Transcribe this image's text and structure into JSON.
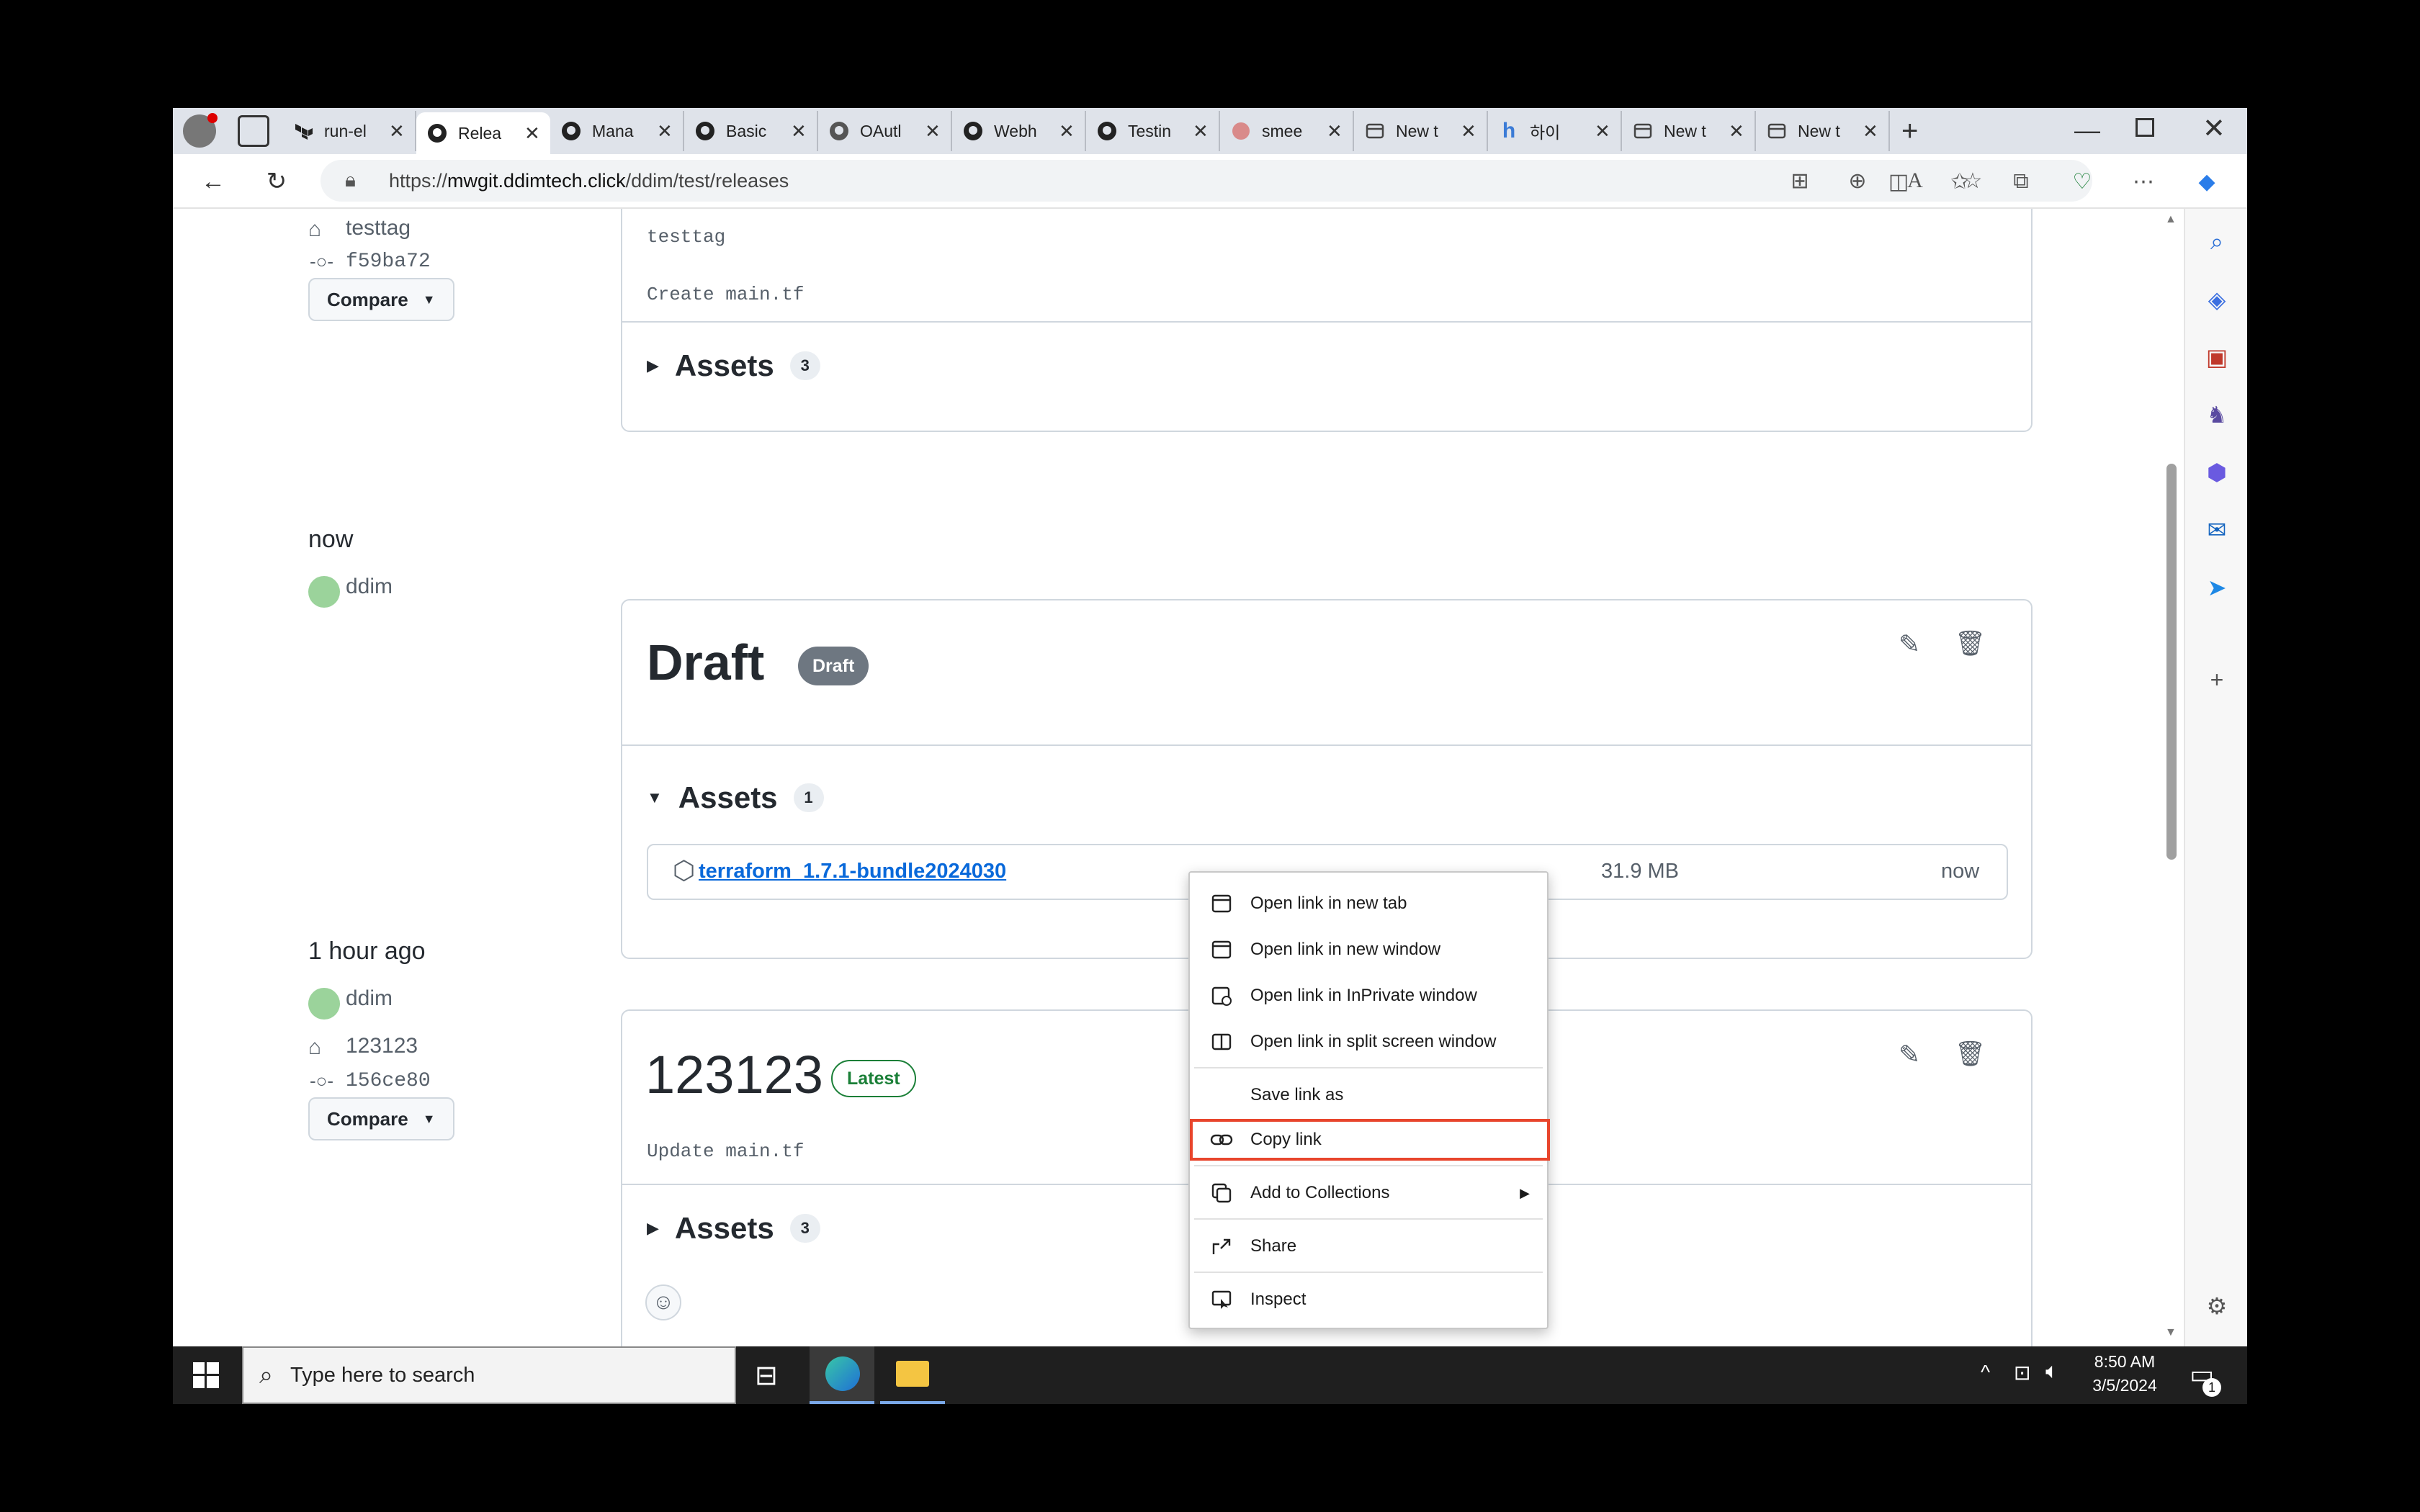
{
  "browser": {
    "tabs": [
      {
        "label": "run-el",
        "icon": "terraform-icon",
        "active": false
      },
      {
        "label": "Relea",
        "icon": "github-icon",
        "active": true
      },
      {
        "label": "Mana",
        "icon": "github-icon",
        "active": false
      },
      {
        "label": "Basic",
        "icon": "github-icon",
        "active": false
      },
      {
        "label": "OAutl",
        "icon": "github-icon",
        "active": false
      },
      {
        "label": "Webh",
        "icon": "github-icon",
        "active": false
      },
      {
        "label": "Testin",
        "icon": "github-icon",
        "active": false
      },
      {
        "label": "smee",
        "icon": "smee-icon",
        "active": false
      },
      {
        "label": "New t",
        "icon": "page-icon",
        "active": false
      },
      {
        "label": "하이",
        "icon": "h-icon",
        "active": false
      },
      {
        "label": "New t",
        "icon": "page-icon",
        "active": false
      },
      {
        "label": "New t",
        "icon": "page-icon",
        "active": false
      }
    ],
    "url": "https://mwgit.ddimtech.click/ddim/test/releases",
    "url_host": "mwgit.ddimtech.click",
    "url_path": "/ddim/test/releases",
    "url_scheme": "https://"
  },
  "releases": {
    "first": {
      "tag": "testtag",
      "commit": "f59ba72",
      "compare_label": "Compare",
      "body_tag": "testtag",
      "body_commit_msg": "Create main.tf",
      "assets_label": "Assets",
      "assets_count": "3"
    },
    "draft": {
      "time": "now",
      "author": "ddim",
      "title": "Draft",
      "badge": "Draft",
      "assets_label": "Assets",
      "assets_count": "1",
      "asset_name": "terraform_1.7.1-bundle2024030",
      "asset_size": "31.9 MB",
      "asset_time": "now"
    },
    "latest": {
      "time": "1 hour ago",
      "author": "ddim",
      "tag": "123123",
      "commit": "156ce80",
      "compare_label": "Compare",
      "title": "123123",
      "badge": "Latest",
      "commit_msg": "Update main.tf",
      "assets_label": "Assets",
      "assets_count": "3"
    }
  },
  "context_menu": {
    "items": [
      {
        "label": "Open link in new tab",
        "icon": "new-tab-icon"
      },
      {
        "label": "Open link in new window",
        "icon": "new-window-icon"
      },
      {
        "label": "Open link in InPrivate window",
        "icon": "inprivate-icon"
      },
      {
        "label": "Open link in split screen window",
        "icon": "split-screen-icon"
      },
      {
        "label": "Save link as",
        "icon": ""
      },
      {
        "label": "Copy link",
        "icon": "link-icon",
        "highlighted": true
      },
      {
        "label": "Add to Collections",
        "icon": "collections-icon",
        "submenu": true
      },
      {
        "label": "Share",
        "icon": "share-icon"
      },
      {
        "label": "Inspect",
        "icon": "inspect-icon"
      }
    ]
  },
  "taskbar": {
    "search_placeholder": "Type here to search",
    "time": "8:50 AM",
    "date": "3/5/2024",
    "notification_count": "1"
  },
  "colors": {
    "highlight_border": "#e8452c",
    "link": "#0969da",
    "latest_badge": "#1a7f37",
    "draft_badge": "#6e7781"
  }
}
